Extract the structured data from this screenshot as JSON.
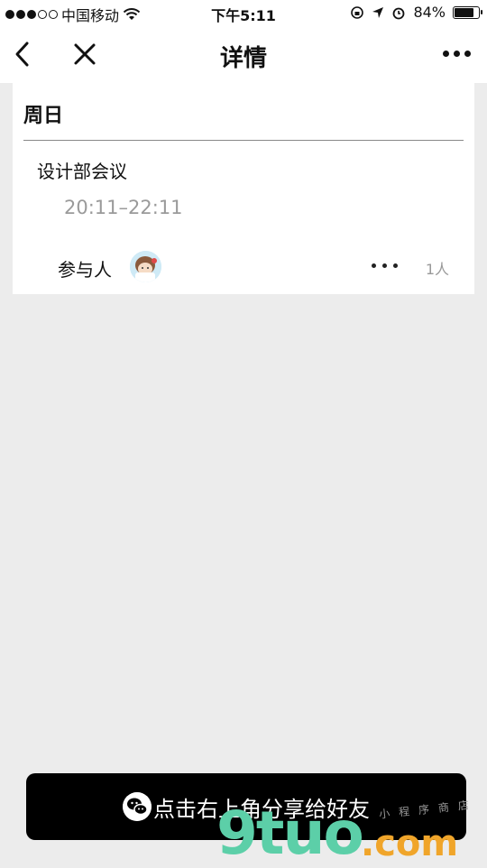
{
  "status_bar": {
    "carrier": "中国移动",
    "time": "下午5:11",
    "battery_percent_label": "84%",
    "battery_level": 0.84,
    "signal_bars_filled": 3,
    "signal_bars_total": 5
  },
  "nav": {
    "title": "详情",
    "back_icon": "chevron-left-icon",
    "close_icon": "close-icon",
    "more_icon": "more-icon"
  },
  "card": {
    "day": "周日",
    "event_title": "设计部会议",
    "event_time": "20:11–22:11",
    "participants_label": "参与人",
    "participant_count": "1人"
  },
  "share_bar": {
    "label": "点击右上角分享给好友",
    "icon": "wechat-icon"
  },
  "watermark": {
    "logo": "9tuo",
    "domain": ".com",
    "caption": "小程序商店"
  },
  "colors": {
    "background": "#ececec",
    "card": "#ffffff",
    "muted_text": "#9a9a9a",
    "share_bar": "#000000",
    "watermark_green": "#5ccfa8",
    "watermark_orange": "#f0a52a"
  }
}
